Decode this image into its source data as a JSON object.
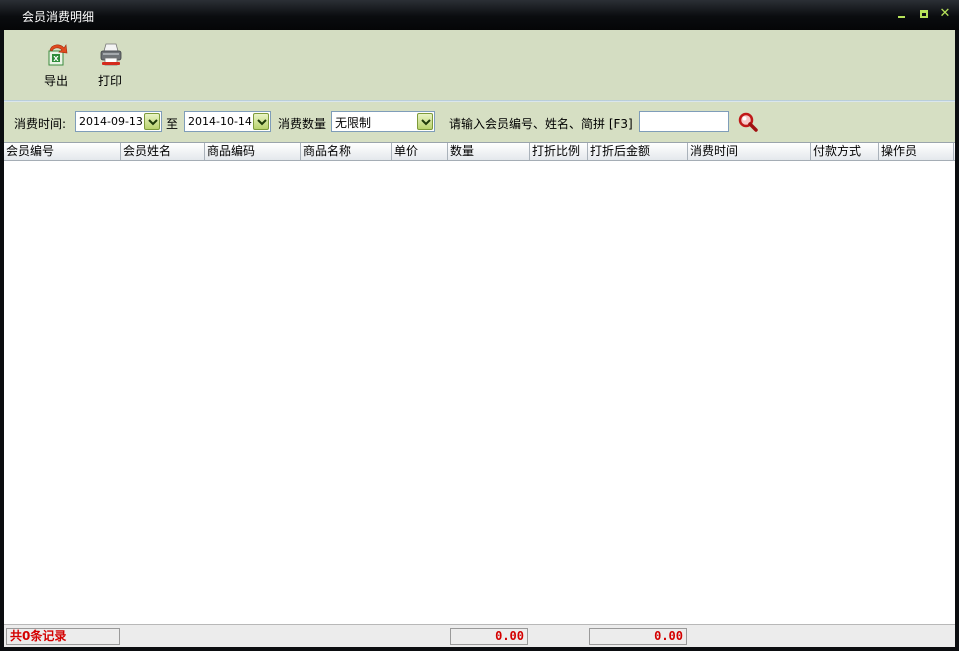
{
  "window": {
    "title": "会员消费明细",
    "minimize": "minimize",
    "maximize": "maximize",
    "close": "✕"
  },
  "toolbar": {
    "export_label": "导出",
    "print_label": "打印"
  },
  "filter": {
    "time_label": "消费时间:",
    "date_from": "2014-09-13",
    "to_label": "至",
    "date_to": "2014-10-14",
    "qty_label": "消费数量",
    "qty_value": "无限制",
    "search_label": "请输入会员编号、姓名、简拼 [F3]",
    "search_value": ""
  },
  "grid": {
    "columns": [
      "会员编号",
      "会员姓名",
      "商品编码",
      "商品名称",
      "单价",
      "数量",
      "打折比例",
      "打折后金额",
      "消费时间",
      "付款方式",
      "操作员"
    ],
    "rows": []
  },
  "status": {
    "record_count": "共0条记录",
    "sum_amount": "0.00",
    "sum_discounted": "0.00"
  },
  "colors": {
    "title_bg": "#0a0c0f",
    "client_bg": "#d6dfc3",
    "accent_green": "#b7e25a",
    "status_red": "#d40000"
  }
}
